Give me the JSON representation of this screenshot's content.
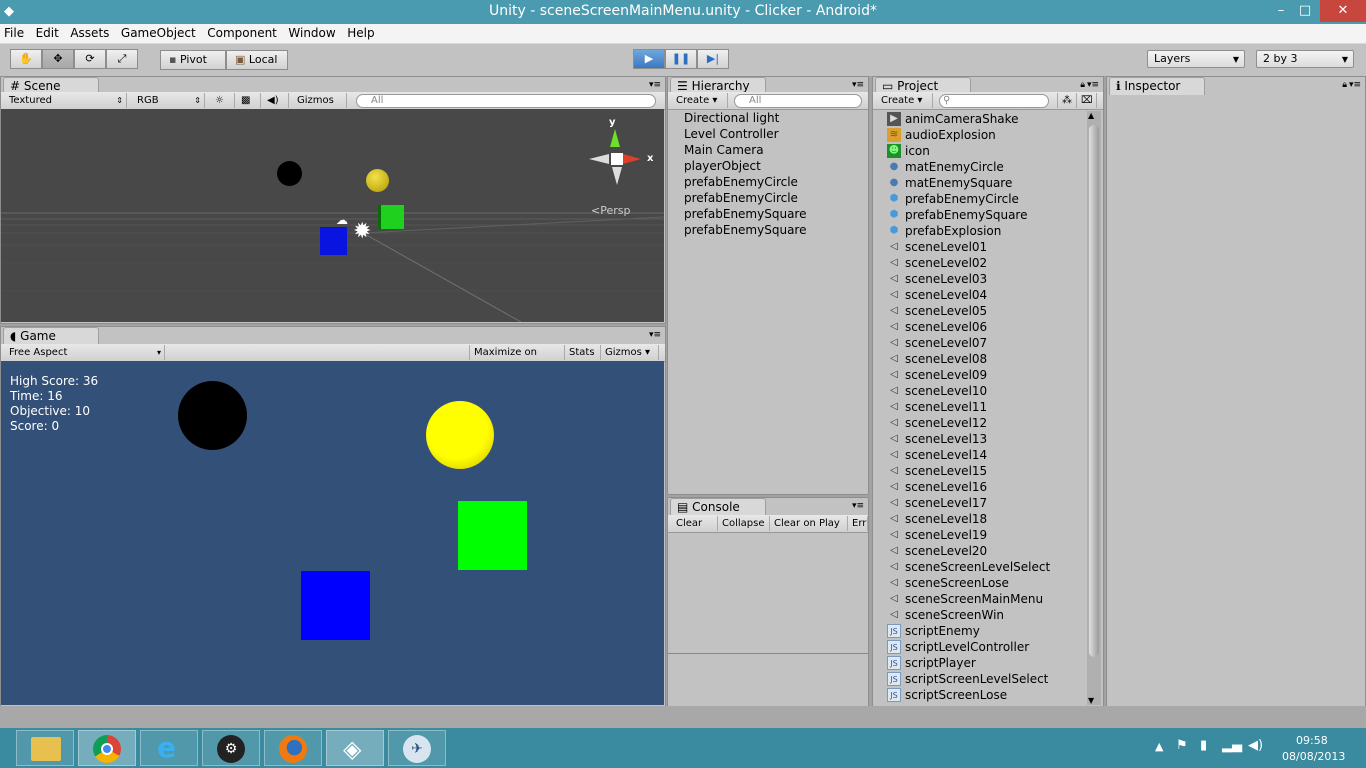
{
  "window": {
    "title": "Unity - sceneScreenMainMenu.unity - Clicker - Android*",
    "minimize": "–",
    "maximize": "□",
    "close": "✕"
  },
  "menu": [
    "File",
    "Edit",
    "Assets",
    "GameObject",
    "Component",
    "Window",
    "Help"
  ],
  "toolbar": {
    "pivot_label": "Pivot",
    "local_label": "Local",
    "layers_label": "Layers",
    "layout_label": "2 by 3",
    "icons": [
      "hand-icon",
      "move-icon",
      "rotate-icon",
      "scale-icon",
      "play-icon",
      "pause-icon",
      "step-icon"
    ]
  },
  "scene": {
    "tab": "Scene",
    "render_mode": "Textured",
    "color_mode": "RGB",
    "gizmos": "Gizmos",
    "search_placeholder": "All",
    "persp_label": "Persp",
    "axis_y": "y",
    "axis_x": "x"
  },
  "game": {
    "tab": "Game",
    "aspect": "Free Aspect",
    "maximize": "Maximize on Play",
    "stats": "Stats",
    "gizmos": "Gizmos",
    "hud": [
      "High Score: 36",
      "Time: 16",
      "Objective: 10",
      "Score: 0"
    ],
    "colors": {
      "background": "#325078",
      "circle_black": "#000000",
      "circle_yellow": "#f5e500",
      "square_green": "#00ff00",
      "square_blue": "#0000ff"
    }
  },
  "hierarchy": {
    "tab": "Hierarchy",
    "create": "Create",
    "search_placeholder": "All",
    "items": [
      "Directional light",
      "Level Controller",
      "Main Camera",
      "playerObject",
      "prefabEnemyCircle",
      "prefabEnemyCircle",
      "prefabEnemySquare",
      "prefabEnemySquare"
    ]
  },
  "console": {
    "tab": "Console",
    "clear": "Clear",
    "collapse": "Collapse",
    "clear_on_play": "Clear on Play",
    "error_pause": "Err"
  },
  "project": {
    "tab": "Project",
    "create": "Create",
    "items": [
      {
        "name": "animCameraShake",
        "icon": "animation-icon"
      },
      {
        "name": "audioExplosion",
        "icon": "audio-icon"
      },
      {
        "name": "icon",
        "icon": "texture-icon"
      },
      {
        "name": "matEnemyCircle",
        "icon": "material-icon"
      },
      {
        "name": "matEnemySquare",
        "icon": "material-icon"
      },
      {
        "name": "prefabEnemyCircle",
        "icon": "prefab-icon"
      },
      {
        "name": "prefabEnemySquare",
        "icon": "prefab-icon"
      },
      {
        "name": "prefabExplosion",
        "icon": "prefab-icon"
      },
      {
        "name": "sceneLevel01",
        "icon": "unity-scene-icon"
      },
      {
        "name": "sceneLevel02",
        "icon": "unity-scene-icon"
      },
      {
        "name": "sceneLevel03",
        "icon": "unity-scene-icon"
      },
      {
        "name": "sceneLevel04",
        "icon": "unity-scene-icon"
      },
      {
        "name": "sceneLevel05",
        "icon": "unity-scene-icon"
      },
      {
        "name": "sceneLevel06",
        "icon": "unity-scene-icon"
      },
      {
        "name": "sceneLevel07",
        "icon": "unity-scene-icon"
      },
      {
        "name": "sceneLevel08",
        "icon": "unity-scene-icon"
      },
      {
        "name": "sceneLevel09",
        "icon": "unity-scene-icon"
      },
      {
        "name": "sceneLevel10",
        "icon": "unity-scene-icon"
      },
      {
        "name": "sceneLevel11",
        "icon": "unity-scene-icon"
      },
      {
        "name": "sceneLevel12",
        "icon": "unity-scene-icon"
      },
      {
        "name": "sceneLevel13",
        "icon": "unity-scene-icon"
      },
      {
        "name": "sceneLevel14",
        "icon": "unity-scene-icon"
      },
      {
        "name": "sceneLevel15",
        "icon": "unity-scene-icon"
      },
      {
        "name": "sceneLevel16",
        "icon": "unity-scene-icon"
      },
      {
        "name": "sceneLevel17",
        "icon": "unity-scene-icon"
      },
      {
        "name": "sceneLevel18",
        "icon": "unity-scene-icon"
      },
      {
        "name": "sceneLevel19",
        "icon": "unity-scene-icon"
      },
      {
        "name": "sceneLevel20",
        "icon": "unity-scene-icon"
      },
      {
        "name": "sceneScreenLevelSelect",
        "icon": "unity-scene-icon"
      },
      {
        "name": "sceneScreenLose",
        "icon": "unity-scene-icon"
      },
      {
        "name": "sceneScreenMainMenu",
        "icon": "unity-scene-icon"
      },
      {
        "name": "sceneScreenWin",
        "icon": "unity-scene-icon"
      },
      {
        "name": "scriptEnemy",
        "icon": "js-script-icon"
      },
      {
        "name": "scriptLevelController",
        "icon": "js-script-icon"
      },
      {
        "name": "scriptPlayer",
        "icon": "js-script-icon"
      },
      {
        "name": "scriptScreenLevelSelect",
        "icon": "js-script-icon"
      },
      {
        "name": "scriptScreenLose",
        "icon": "js-script-icon"
      }
    ]
  },
  "inspector": {
    "tab": "Inspector"
  },
  "taskbar": {
    "apps": [
      "file-explorer-icon",
      "chrome-icon",
      "internet-explorer-icon",
      "steam-icon",
      "firefox-icon",
      "unity-icon",
      "remote-app-icon"
    ],
    "time": "09:58",
    "date": "08/08/2013"
  }
}
